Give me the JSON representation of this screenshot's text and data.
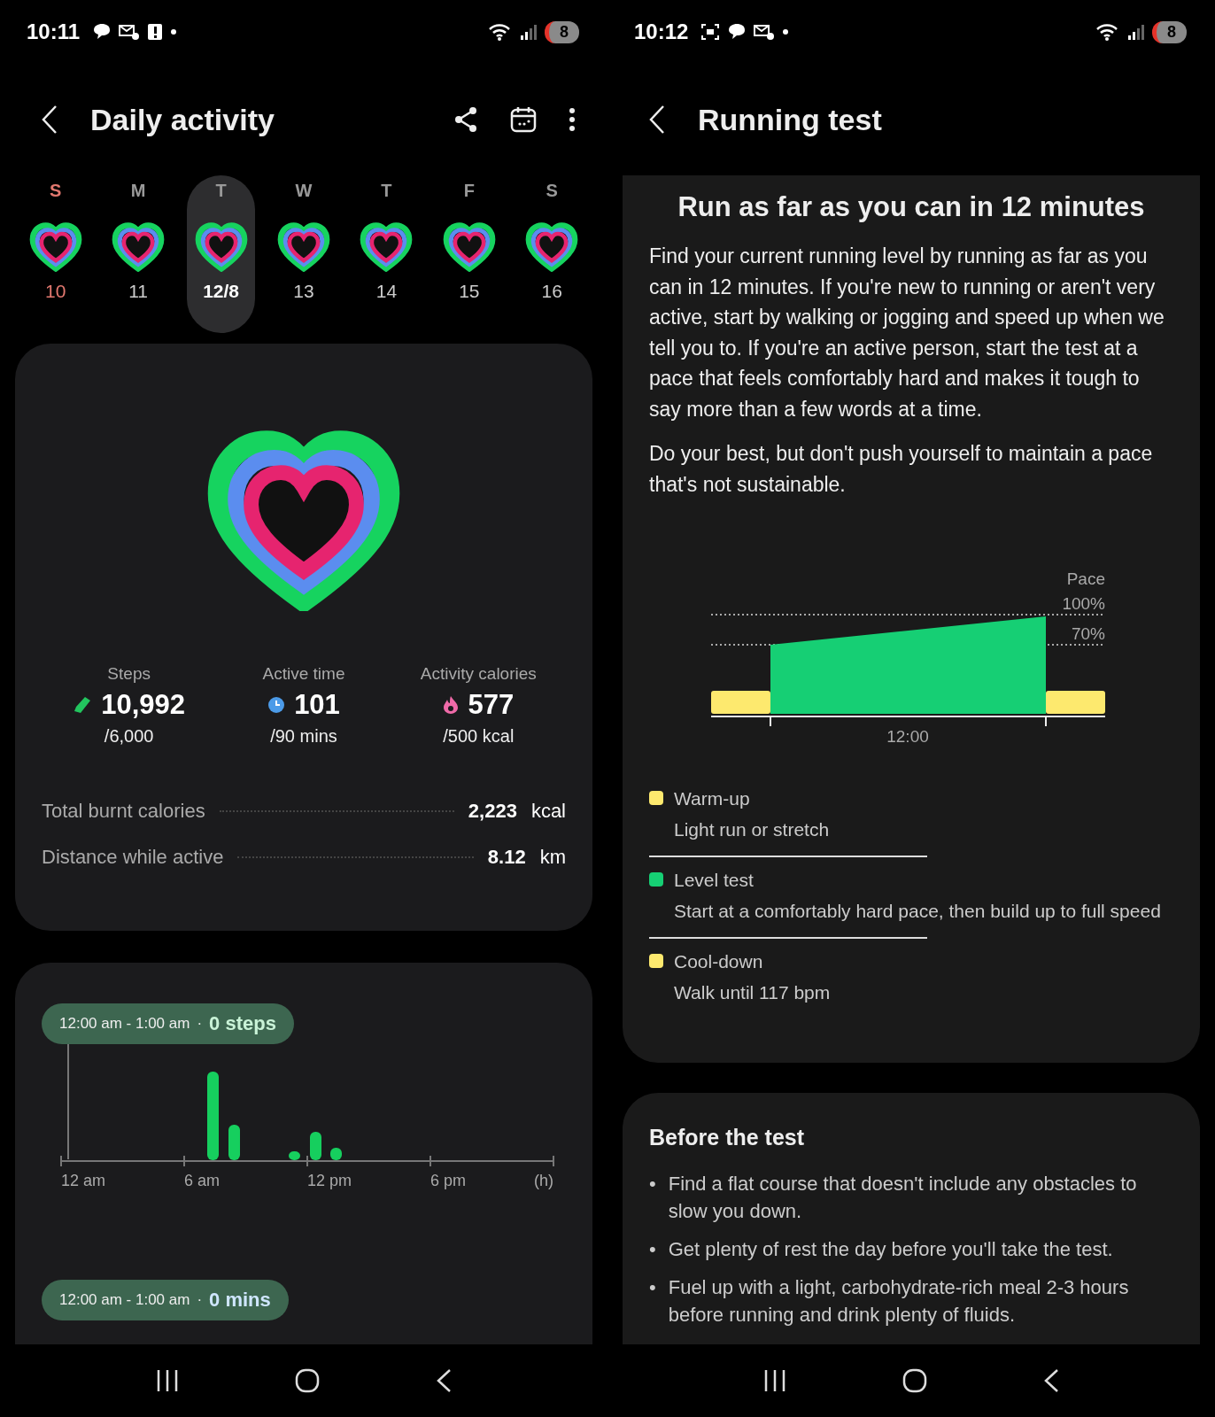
{
  "left": {
    "status": {
      "time": "10:11",
      "battery": "8"
    },
    "title": "Daily activity",
    "week": [
      {
        "day": "S",
        "date": "10",
        "kind": "sunday",
        "selected": false
      },
      {
        "day": "M",
        "date": "11",
        "kind": "weekday",
        "selected": false
      },
      {
        "day": "T",
        "date": "12/8",
        "kind": "weekday",
        "selected": true
      },
      {
        "day": "W",
        "date": "13",
        "kind": "weekday",
        "selected": false
      },
      {
        "day": "T",
        "date": "14",
        "kind": "weekday",
        "selected": false
      },
      {
        "day": "F",
        "date": "15",
        "kind": "weekday",
        "selected": false
      },
      {
        "day": "S",
        "date": "16",
        "kind": "weekday",
        "selected": false
      }
    ],
    "summary": {
      "stats": [
        {
          "kind": "steps",
          "label": "Steps",
          "value": "10,992",
          "goal": "/6,000"
        },
        {
          "kind": "time",
          "label": "Active time",
          "value": "101",
          "goal": "/90 mins"
        },
        {
          "kind": "calories",
          "label": "Activity calories",
          "value": "577",
          "goal": "/500 kcal"
        }
      ],
      "rows": [
        {
          "label": "Total burnt calories",
          "value": "2,223",
          "unit": "kcal"
        },
        {
          "label": "Distance while active",
          "value": "8.12",
          "unit": "km"
        }
      ]
    },
    "steps_chart": {
      "tooltip": {
        "range": "12:00 am - 1:00 am",
        "separator": "·",
        "value": "0 steps"
      },
      "x_labels": [
        "12 am",
        "6 am",
        "12 pm",
        "6 pm",
        "(h)"
      ]
    },
    "active_time_tooltip": {
      "range": "12:00 am - 1:00 am",
      "separator": "·",
      "value": "0 mins"
    }
  },
  "right": {
    "status": {
      "time": "10:12",
      "battery": "8"
    },
    "title": "Running test",
    "card": {
      "heading": "Run as far as you can in 12 minutes",
      "paragraphs": [
        "Find your current running level by running as far as you can in 12 minutes. If you're new to running or aren't very active, start by walking or jogging and speed up when we tell you to. If you're an active person, start the test at a pace that feels comfortably hard and makes it tough to say more than a few words at a time.",
        "Do your best, but don't push yourself to maintain a pace that's not sustainable."
      ],
      "chart_labels": {
        "axis": "Pace",
        "high": "100%",
        "low": "70%",
        "duration": "12:00"
      },
      "legend": [
        {
          "title": "Warm-up",
          "text": "Light run or stretch",
          "color": "#fde96e"
        },
        {
          "title": "Level test",
          "text": "Start at a comfortably hard pace, then build up to full speed",
          "color": "#16cf74"
        },
        {
          "title": "Cool-down",
          "text": "Walk until 117 bpm",
          "color": "#fde96e"
        }
      ]
    },
    "before": {
      "heading": "Before the test",
      "bullets": [
        {
          "marker": "•",
          "text": "Find a flat course that doesn't include any obstacles to slow you down."
        },
        {
          "marker": "•",
          "text": "Get plenty of rest the day before you'll take the test."
        },
        {
          "marker": "•",
          "text": "Fuel up with a light, carbohydrate-rich meal 2-3 hours before running and drink plenty of fluids."
        }
      ]
    }
  }
}
